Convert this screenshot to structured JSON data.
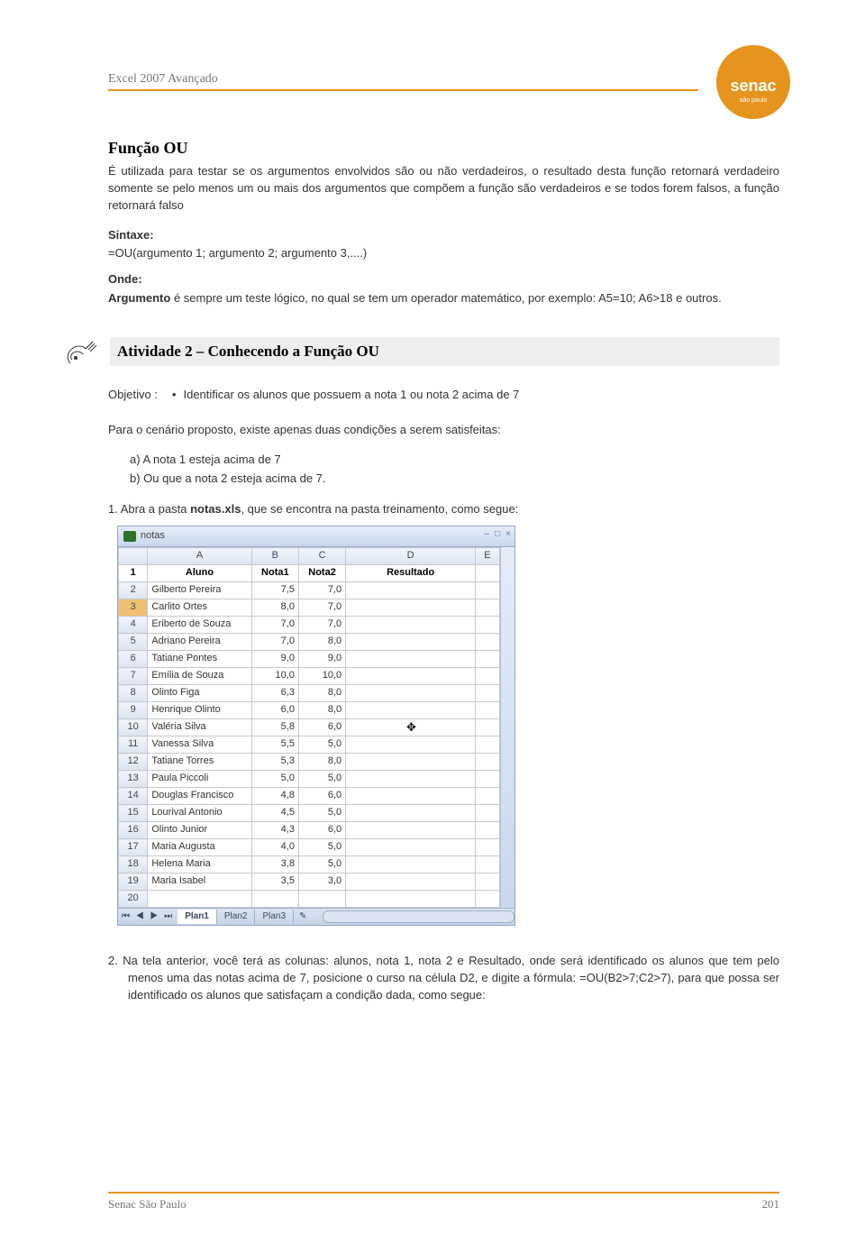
{
  "header": {
    "title": "Excel 2007 Avançado"
  },
  "logo": {
    "name": "senac",
    "sub": "são paulo"
  },
  "section": {
    "title": "Função OU",
    "intro": "É utilizada para testar se os argumentos envolvidos são ou não verdadeiros, o resultado desta função retornará verdadeiro somente se pelo menos um ou mais dos argumentos que compõem a função são verdadeiros e se todos forem falsos, a função retornará falso",
    "syntax_label": "Sintaxe:",
    "syntax": "=OU(argumento 1; argumento 2; argumento 3,....)",
    "where_label": "Onde:",
    "where_text_pre": "Argumento",
    "where_text": " é sempre um teste lógico, no qual se tem um operador matemático, por exemplo: A5=10; A6>18 e outros."
  },
  "activity": {
    "title": "Atividade 2 – Conhecendo a Função OU",
    "objective_label": "Objetivo   :",
    "objective_text": "Identificar os alunos que possuem a nota 1 ou nota 2 acima de 7",
    "scenario": "Para o cenário proposto, existe apenas duas condições a serem satisfeitas:",
    "cond_a": "a)   A nota 1 esteja acima de 7",
    "cond_b": "b)   Ou que a nota 2 esteja acima de 7.",
    "step1_pre": "1.   Abra a pasta ",
    "step1_file": "notas.xls",
    "step1_post": ", que se encontra na pasta treinamento, como segue:",
    "step2": "2.  Na tela anterior, você terá as colunas: alunos, nota 1, nota 2 e Resultado, onde será identificado os alunos que tem pelo menos uma das notas acima de 7, posicione o curso na célula D2, e digite a fórmula: =OU(B2>7;C2>7), para que possa ser identificado os alunos que satisfaçam a condição dada, como segue:"
  },
  "spreadsheet": {
    "window_title": "notas",
    "columns": [
      "",
      "A",
      "B",
      "C",
      "D",
      "E"
    ],
    "headers": [
      "Aluno",
      "Nota1",
      "Nota2",
      "Resultado"
    ],
    "rows": [
      {
        "n": "2",
        "a": "Gilberto Pereira",
        "b": "7,5",
        "c": "7,0"
      },
      {
        "n": "3",
        "a": "Carlito Ortes",
        "b": "8,0",
        "c": "7,0",
        "sel": true
      },
      {
        "n": "4",
        "a": "Eriberto de Souza",
        "b": "7,0",
        "c": "7,0"
      },
      {
        "n": "5",
        "a": "Adriano Pereira",
        "b": "7,0",
        "c": "8,0"
      },
      {
        "n": "6",
        "a": "Tatiane Pontes",
        "b": "9,0",
        "c": "9,0"
      },
      {
        "n": "7",
        "a": "Emília de Souza",
        "b": "10,0",
        "c": "10,0"
      },
      {
        "n": "8",
        "a": "Olinto Figa",
        "b": "6,3",
        "c": "8,0"
      },
      {
        "n": "9",
        "a": "Henrique Olinto",
        "b": "6,0",
        "c": "8,0"
      },
      {
        "n": "10",
        "a": "Valéria Silva",
        "b": "5,8",
        "c": "6,0"
      },
      {
        "n": "11",
        "a": "Vanessa Silva",
        "b": "5,5",
        "c": "5,0"
      },
      {
        "n": "12",
        "a": "Tatiane Torres",
        "b": "5,3",
        "c": "8,0"
      },
      {
        "n": "13",
        "a": "Paula Piccoli",
        "b": "5,0",
        "c": "5,0"
      },
      {
        "n": "14",
        "a": "Douglas Francisco",
        "b": "4,8",
        "c": "6,0"
      },
      {
        "n": "15",
        "a": "Lourival Antonio",
        "b": "4,5",
        "c": "5,0"
      },
      {
        "n": "16",
        "a": "Olinto Junior",
        "b": "4,3",
        "c": "6,0"
      },
      {
        "n": "17",
        "a": "Maria Augusta",
        "b": "4,0",
        "c": "5,0"
      },
      {
        "n": "18",
        "a": "Helena Maria",
        "b": "3,8",
        "c": "5,0"
      },
      {
        "n": "19",
        "a": "Maria Isabel",
        "b": "3,5",
        "c": "3,0"
      },
      {
        "n": "20",
        "a": "",
        "b": "",
        "c": ""
      }
    ],
    "tabs": [
      "Plan1",
      "Plan2",
      "Plan3"
    ]
  },
  "footer": {
    "left": "Senac São Paulo",
    "right": "201"
  }
}
